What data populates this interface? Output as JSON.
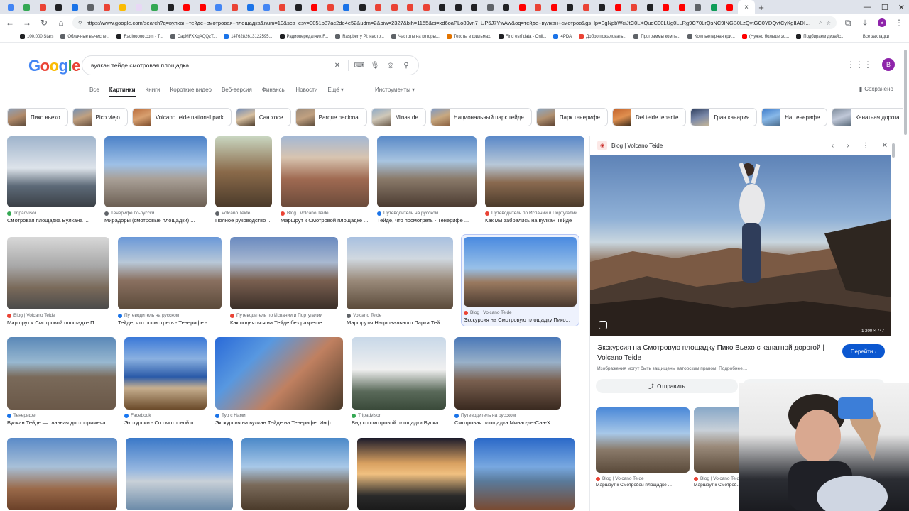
{
  "browser": {
    "url": "https://www.google.com/search?q=вулкан+тейде+смотровая+площадка&num=10&sca_esv=0051b87ac2de4e52&udm=2&biw=2327&bih=1155&ei=xd6oaPLo89vn7_UP5J7YwAw&oq=тейде+вулкан+смотров&gs_lp=EgNpbWciJtC0LXQudC00LUg0LLRg9C70LrQsNC9INGB0LzQvtGC0YDQvtCyKgIIADIGEAAYCBgeSIUSUI4CWNkLcAF4AJA...",
    "back_icon": "arrow-left-icon",
    "forward_icon": "arrow-right-icon",
    "reload_icon": "reload-icon",
    "home_icon": "home-icon",
    "new_tab_label": "+",
    "active_tab_close": "×",
    "bookmarks": [
      "100.000 Stars",
      "Облачные вычисле...",
      "Radiooooo.com - T...",
      "CapMFXXqAQQzT...",
      "1476282613122595...",
      "Радиопередатчик F...",
      "Raspberry Pi: настр...",
      "Частоты на которы...",
      "Тексты в фильмах.",
      "Find esrf data - Onli...",
      "4PDA",
      "Добро пожаловать...",
      "Программы компь...",
      "Компьютерная кри...",
      "(Нужно больше эо...",
      "Подбираем дизайс..."
    ],
    "all_bookmarks": "Все закладки",
    "tab_colors": [
      "#4285f4",
      "#34a853",
      "#ea4335",
      "#202124",
      "#1a73e8",
      "#5f6368",
      "#ea4335",
      "#fbbc04",
      "#e8d8f5",
      "#34a853",
      "#202124",
      "#ff0000",
      "#ff0000",
      "#4285f4",
      "#ea4335",
      "#1a73e8",
      "#4285f4",
      "#ea4335",
      "#202124",
      "#ff0000",
      "#ea4335",
      "#1a73e8",
      "#202124",
      "#ea4335",
      "#ea4335",
      "#ea4335",
      "#ea4335",
      "#202124",
      "#202124",
      "#202124",
      "#5f6368",
      "#202124",
      "#ff0000",
      "#ea4335",
      "#ff0000",
      "#202124",
      "#ea4335",
      "#202124",
      "#ff0000",
      "#ea4335",
      "#202124",
      "#ff0000",
      "#ff0000",
      "#5f6368",
      "#0f9d58",
      "#ff0000"
    ]
  },
  "google": {
    "logo": "Google",
    "query": "вулкан тейде смотровая площадка",
    "avatar_letter": "B",
    "filters": [
      "Все",
      "Картинки",
      "Книги",
      "Короткие видео",
      "Веб-версия",
      "Финансы",
      "Новости",
      "Ещё ▾"
    ],
    "tools": "Инструменты ▾",
    "saved": "Сохранено",
    "chips": [
      "Пико вьехо",
      "Pico viejo",
      "Volcano teide national park",
      "Сан хосе",
      "Parque nacional",
      "Minas de",
      "Национальный парк тейде",
      "Парк тенерифе",
      "Del teide tenerife",
      "Гран канария",
      "На тенерифе",
      "Канатная дорога"
    ]
  },
  "results": [
    [
      {
        "src": "Tripadvisor",
        "cap": "Смотровая площадка Вулкана ...",
        "c": "#34a853"
      },
      {
        "src": "Тенерифе по-русски",
        "cap": "Мирадоры (смотровые площадки) ...",
        "c": "#5f6368"
      },
      {
        "src": "Volcano Teide",
        "cap": "Полное руководство ...",
        "c": "#5f6368"
      },
      {
        "src": "Blog | Volcano Teide",
        "cap": "Маршрут к Смотровой площадке ...",
        "c": "#ea4335"
      },
      {
        "src": "Путеводитель на русском",
        "cap": "Тейде, что посмотреть - Тенерифе ...",
        "c": "#1a73e8"
      },
      {
        "src": "Путеводитель по Испании и Португалии",
        "cap": "Как мы забрались на вулкан Тейде",
        "c": "#ea4335"
      }
    ],
    [
      {
        "src": "Blog | Volcano Teide",
        "cap": "Маршрут к Смотровой площадке П...",
        "c": "#ea4335"
      },
      {
        "src": "Путеводитель на русском",
        "cap": "Тейде, что посмотреть - Тенерифе - ...",
        "c": "#1a73e8"
      },
      {
        "src": "Путеводитель по Испании и Португалии",
        "cap": "Как подняться на Тейде без разреше...",
        "c": "#ea4335"
      },
      {
        "src": "Volcano Teide",
        "cap": "Маршруты Национального Парка Тей...",
        "c": "#5f6368"
      },
      {
        "src": "Blog | Volcano Teide",
        "cap": "Экскурсия на Смотровую площадку Пико...",
        "c": "#ea4335"
      }
    ],
    [
      {
        "src": "Тенерифе",
        "cap": "Вулкан Тейде — главная достопримеча...",
        "c": "#1a73e8"
      },
      {
        "src": "Facebook",
        "cap": "Экскурсии - Со смотровой п...",
        "c": "#1877f2"
      },
      {
        "src": "Тур с Нами",
        "cap": "Экскурсия на вулкан Тейде на Тенерифе. Инф...",
        "c": "#1a73e8"
      },
      {
        "src": "Tripadvisor",
        "cap": "Вид со смотровой площадки Вулка...",
        "c": "#34a853"
      },
      {
        "src": "Путеводитель на русском",
        "cap": "Смотровая площадка Минас-де-Сан-Х...",
        "c": "#1a73e8"
      }
    ],
    [
      {
        "src": "",
        "cap": "",
        "c": "#fff"
      },
      {
        "src": "",
        "cap": "",
        "c": "#fff"
      },
      {
        "src": "",
        "cap": "",
        "c": "#fff"
      },
      {
        "src": "",
        "cap": "",
        "c": "#fff"
      },
      {
        "src": "",
        "cap": "",
        "c": "#fff"
      }
    ]
  ],
  "panel": {
    "source": "Blog | Volcano Teide",
    "dimensions": "1 200 × 747",
    "title": "Экскурсия на Смотровую площадку Пико Вьехо с канатной дорогой | Volcano Teide",
    "visit": "Перейти ›",
    "note": "Изображения могут быть защищены авторским правом. Подробнее…",
    "share": "Отправить",
    "related": [
      {
        "src": "Blog | Volcano Teide",
        "cap": "Маршрут к Смотровой площадке ..."
      },
      {
        "src": "Blog | Volcano Teide",
        "cap": "Маршрут к Смотров..."
      }
    ]
  }
}
